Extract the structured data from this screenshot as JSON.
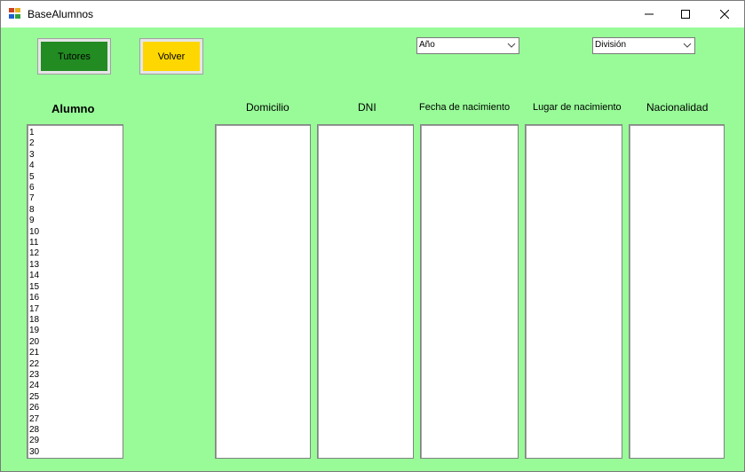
{
  "window": {
    "title": "BaseAlumnos"
  },
  "buttons": {
    "tutores": "Tutores",
    "volver": "Volver"
  },
  "combos": {
    "anio": "Año",
    "division": "División"
  },
  "headers": {
    "alumno": "Alumno",
    "domicilio": "Domicilio",
    "dni": "DNI",
    "fecha": "Fecha de nacimiento",
    "lugar": "Lugar de nacimiento",
    "nacionalidad": "Nacionalidad"
  },
  "alumnos": [
    "1",
    "2",
    "3",
    "4",
    "5",
    "6",
    "7",
    "8",
    "9",
    "10",
    "11",
    "12",
    "13",
    "14",
    "15",
    "16",
    "17",
    "18",
    "19",
    "20",
    "21",
    "22",
    "23",
    "24",
    "25",
    "26",
    "27",
    "28",
    "29",
    "30"
  ],
  "colors": {
    "background": "#98fb98",
    "tutores": "#228b22",
    "volver": "#ffd700"
  }
}
